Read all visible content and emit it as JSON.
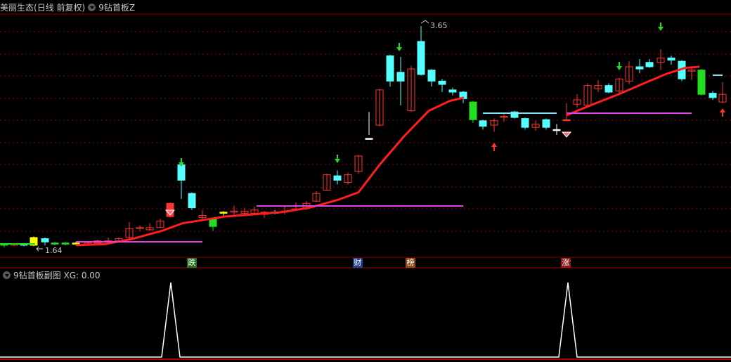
{
  "header": {
    "stock_name": "美丽生态",
    "period": "(日线 前复权)",
    "indicator": "9钻首板Z"
  },
  "subchart": {
    "title": "9钻首板副图",
    "value_label": "XG: 0.00"
  },
  "colors": {
    "up": "#ff3232",
    "down": "#54ffff",
    "ma": "#ff1e1e",
    "support": "#e040e0",
    "level": "#7fe7f7",
    "grid": "#8b0000",
    "signal_line": "#ffffff"
  },
  "chart_data": [
    {
      "type": "candlestick",
      "y_labels": [
        "3.65",
        "1.64"
      ],
      "high_value": 3.65,
      "low_value": 1.64,
      "tags": [
        {
          "text": "跌",
          "color": "#1f6f1f"
        },
        {
          "text": "财",
          "color": "#1f3f8f"
        },
        {
          "text": "榜",
          "color": "#8a4a10"
        },
        {
          "text": "涨",
          "color": "#8a1a1a"
        }
      ]
    },
    {
      "type": "line",
      "name": "XG",
      "values": [
        0,
        1,
        0,
        1,
        0
      ],
      "current": 0.0
    }
  ]
}
